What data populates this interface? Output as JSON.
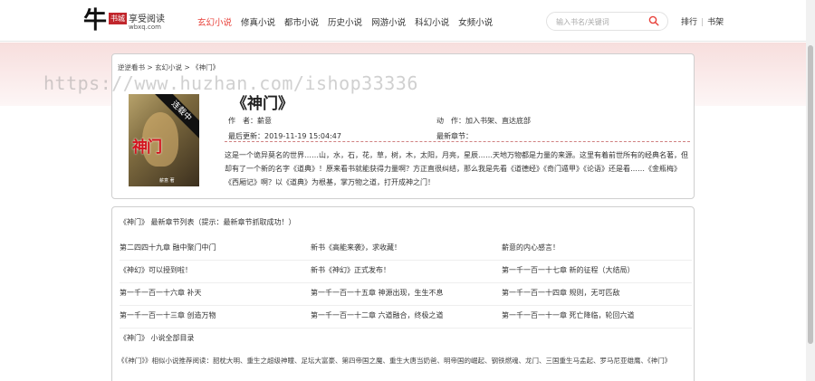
{
  "logo": {
    "char": "牛",
    "seal": "书城",
    "text": "享受阅读",
    "domain": "wbxq.com"
  },
  "nav": {
    "items": [
      {
        "label": "玄幻小说",
        "active": true
      },
      {
        "label": "修真小说",
        "active": false
      },
      {
        "label": "都市小说",
        "active": false
      },
      {
        "label": "历史小说",
        "active": false
      },
      {
        "label": "网游小说",
        "active": false
      },
      {
        "label": "科幻小说",
        "active": false
      },
      {
        "label": "女频小说",
        "active": false
      }
    ]
  },
  "search": {
    "placeholder": "输入书名/关键词",
    "icon": "search-icon"
  },
  "header_links": {
    "rank": "排行",
    "shelf": "书架"
  },
  "watermark": "https://www.huzhan.com/ishop33336",
  "breadcrumb": {
    "home": "逆逆看书",
    "sep1": " > ",
    "category": "玄幻小说",
    "sep2": " > ",
    "current": "《神门》"
  },
  "book": {
    "title": "《神门》",
    "cover_title": "神门",
    "cover_badge": "连载中",
    "cover_author": "薪意 著",
    "author_label": "作　者：",
    "author": "薪意",
    "action_label": "动　作：",
    "add_shelf": "加入书架",
    "sep": "、",
    "goto_bottom": "直达底部",
    "updated_label": "最后更新：",
    "updated": "2019-11-19 15:04:47",
    "latest_label": "最新章节：",
    "latest": "",
    "intro": "这是一个诡异莫名的世界……山，水，石，花，草，树，木，太阳，月亮，星辰……天地万物都是力量的来源。这里有着前世所有的经典名著，但却有了一个新的名字《道典》！原来看书就能获得力量啊？方正直很纠结，那么我是先看《道德经》《奇门遁甲》《论语》还是看……《金瓶梅》《西厢记》啊？以《道典》为根基，掌万物之道，打开成神之门！"
  },
  "chapters": {
    "header": "《神门》 最新章节列表（提示：最新章节抓取成功！）",
    "rows": [
      [
        "第二四四十九章 融中聚门中门",
        "新书《高能来袭》，求收藏！",
        "薪意的内心感言！"
      ],
      [
        "《神幻》可以授到啦！",
        "新书《神幻》正式发布！",
        "第一千一百一十七章 新的征程（大结局）"
      ],
      [
        "第一千一百一十六章 补天",
        "第一千一百一十五章 神源出现，生生不息",
        "第一千一百一十四章 规则，无可匹敌"
      ],
      [
        "第一千一百一十三章 创造万物",
        "第一千一百一十二章 六道融合，终极之道",
        "第一千一百一十一章 死亡降临，轮回六道"
      ]
    ],
    "catalog": "《神门》 小说全部目录",
    "recommend": "《《神门》》相似小说推荐阅读：韶枕大明、重生之超级神瞳、足坛大富豪、第四帝国之魔、重生大唐当奶爸、明帝国的崛起、钢铁燃魂、龙门、三国重生马孟起、罗马尼亚雄鹰、《神门》"
  }
}
